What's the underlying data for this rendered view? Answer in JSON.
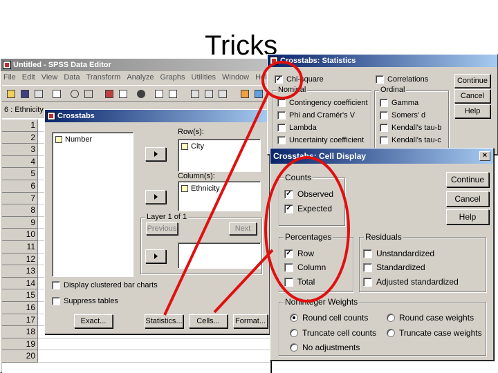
{
  "slide": {
    "title": "Tricks"
  },
  "spss": {
    "title": "Untitled - SPSS Data Editor",
    "menu": [
      "File",
      "Edit",
      "View",
      "Data",
      "Transform",
      "Analyze",
      "Graphs",
      "Utilities",
      "Window",
      "Help"
    ],
    "cell_ref": "6 : Ethnicity",
    "rows": [
      "1",
      "2",
      "3",
      "4",
      "5",
      "6",
      "7",
      "8",
      "9",
      "10",
      "11",
      "12",
      "13",
      "14",
      "15",
      "16",
      "17",
      "18",
      "19",
      "20"
    ]
  },
  "crosstabs": {
    "title": "Crosstabs",
    "source_list": [
      "Number"
    ],
    "rows_label": "Row(s):",
    "rows_list": [
      "City"
    ],
    "columns_label": "Column(s):",
    "columns_list": [
      "Ethnicity"
    ],
    "layer_label": "Layer 1 of 1",
    "previous": "Previous",
    "next": "Next",
    "display_clustered": "Display clustered bar charts",
    "suppress_tables": "Suppress tables",
    "exact": "Exact...",
    "statistics": "Statistics...",
    "cells": "Cells...",
    "format": "Format..."
  },
  "statistics": {
    "title": "Crosstabs: Statistics",
    "chi_square": "Chi-square",
    "correlations": "Correlations",
    "nominal_label": "Nominal",
    "ordinal_label": "Ordinal",
    "nominal": [
      "Contingency coefficient",
      "Phi and Cramér's V",
      "Lambda",
      "Uncertainty coefficient"
    ],
    "ordinal": [
      "Gamma",
      "Somers' d",
      "Kendall's tau-b",
      "Kendall's tau-c"
    ],
    "continue": "Continue",
    "cancel": "Cancel",
    "help": "Help"
  },
  "cell_display": {
    "title": "Crosstabs: Cell Display",
    "counts_label": "Counts",
    "observed": "Observed",
    "expected": "Expected",
    "percentages_label": "Percentages",
    "row": "Row",
    "column": "Column",
    "total": "Total",
    "residuals_label": "Residuals",
    "unstandardized": "Unstandardized",
    "standardized": "Standardized",
    "adjusted_standardized": "Adjusted standardized",
    "noninteger_label": "Noninteger Weights",
    "round_cell": "Round cell counts",
    "round_case": "Round case weights",
    "truncate_cell": "Truncate cell counts",
    "truncate_case": "Truncate case weights",
    "no_adjustments": "No adjustments",
    "continue": "Continue",
    "cancel": "Cancel",
    "help": "Help",
    "close": "×"
  },
  "colors": {
    "annotation": "#e01010",
    "titlebar": "#0a246a",
    "dialog": "#d4d0c8"
  }
}
